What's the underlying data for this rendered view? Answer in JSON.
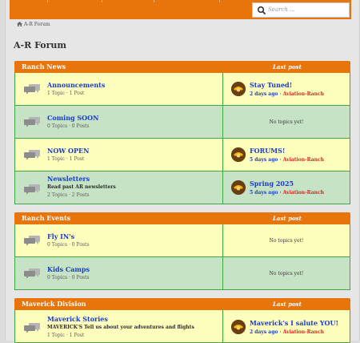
{
  "header": {
    "search_placeholder": "Search ...",
    "accent": "#e8740c"
  },
  "breadcrumb": {
    "label": "A-R Forum",
    "icon": "home-icon"
  },
  "page_title": "A-R Forum",
  "sections": [
    {
      "name": "Ranch News",
      "last_post_label": "Last post",
      "forums": [
        {
          "name": "Announcements",
          "description": "",
          "stats": "1 Topic · 1 Post",
          "last": {
            "title": "Stay Tuned!",
            "when": "2 days ago",
            "sep": " · ",
            "user": "Aviation-Ranch"
          }
        },
        {
          "name": "Coming SOON",
          "description": "",
          "stats": "0 Topics · 0 Posts",
          "empty": "No topics yet!"
        },
        {
          "name": "NOW OPEN",
          "description": "",
          "stats": "1 Topic · 1 Post",
          "last": {
            "title": "FORUMS!",
            "when": "5 days ago",
            "sep": " · ",
            "user": "Aviation-Ranch"
          }
        },
        {
          "name": "Newsletters",
          "description": "Read past AR newsletters",
          "stats": "2 Topics · 2 Posts",
          "last": {
            "title": "Spring 2025",
            "when": "5 days ago",
            "sep": " · ",
            "user": "Aviation-Ranch"
          }
        }
      ]
    },
    {
      "name": "Ranch Events",
      "last_post_label": "Last post",
      "forums": [
        {
          "name": "Fly IN's",
          "description": "",
          "stats": "0 Topics · 0 Posts",
          "empty": "No topics yet!"
        },
        {
          "name": "Kids Camps",
          "description": "",
          "stats": "0 Topics · 0 Posts",
          "empty": "No topics yet!"
        }
      ]
    },
    {
      "name": "Maverick Division",
      "last_post_label": "Last post",
      "forums": [
        {
          "name": "Maverick Stories",
          "description": "MAVERICK'S Tell us about your adventures and flights",
          "stats": "1 Topic · 1 Post",
          "last": {
            "title": "Maverick's I salute YOU!",
            "when": "2 days ago",
            "sep": " · ",
            "user": "Aviation-Ranch"
          }
        }
      ]
    }
  ]
}
